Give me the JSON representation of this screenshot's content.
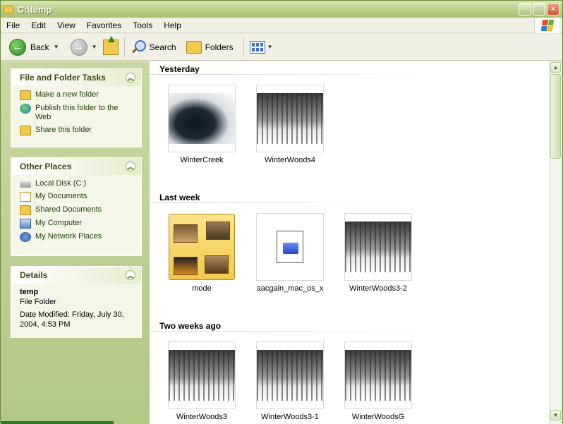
{
  "window": {
    "title": "C:\\temp"
  },
  "menu": [
    "File",
    "Edit",
    "View",
    "Favorites",
    "Tools",
    "Help"
  ],
  "toolbar": {
    "back": "Back",
    "search": "Search",
    "folders": "Folders"
  },
  "tasks": {
    "file_folder": {
      "title": "File and Folder Tasks",
      "items": [
        "Make a new folder",
        "Publish this folder to the Web",
        "Share this folder"
      ]
    },
    "other_places": {
      "title": "Other Places",
      "items": [
        "Local Disk (C:)",
        "My Documents",
        "Shared Documents",
        "My Computer",
        "My Network Places"
      ]
    },
    "details": {
      "title": "Details",
      "name": "temp",
      "type": "File Folder",
      "modified_1": "Date Modified: Friday, July 30,",
      "modified_2": "2004, 4:53 PM"
    }
  },
  "groups": [
    {
      "title": "Yesterday",
      "items": [
        "WinterCreek",
        "WinterWoods4"
      ]
    },
    {
      "title": "Last week",
      "items": [
        "mode",
        "aacgain_mac_os_x",
        "WinterWoods3-2"
      ]
    },
    {
      "title": "Two weeks ago",
      "items": [
        "WinterWoods3",
        "WinterWoods3-1",
        "WinterWoodsG"
      ]
    }
  ],
  "colors": {
    "accent": "#3a4d14",
    "titlebar": "#a8c172",
    "taskpane": "#c8d8a3"
  }
}
